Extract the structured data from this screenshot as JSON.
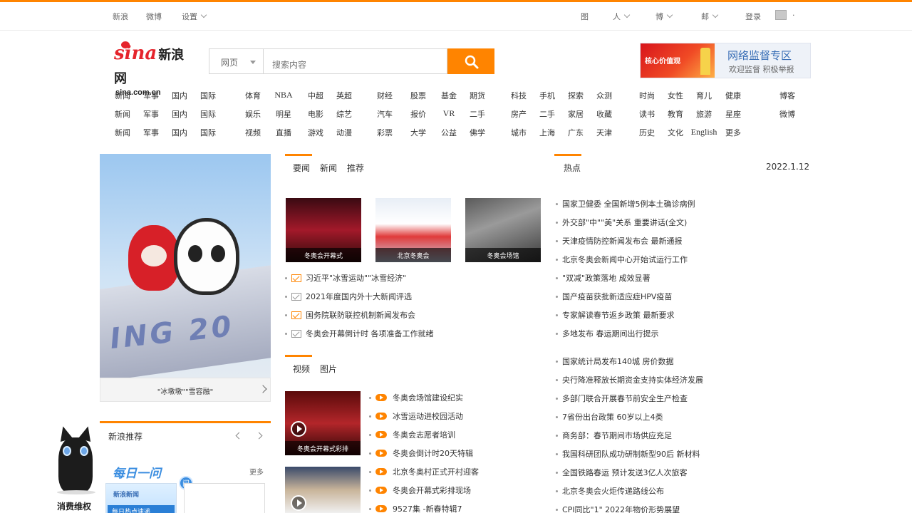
{
  "topbar": {
    "left_items": [
      "新浪",
      "微博",
      "设置"
    ],
    "right_items": [
      "图",
      "人",
      "博",
      "邮",
      "登录"
    ]
  },
  "logo": {
    "main": "sina",
    "cn": "新浪网",
    "sub": "sina.com.cn"
  },
  "search": {
    "select_label": "网页",
    "placeholder": "搜索内容"
  },
  "banner": {
    "left_text": "核心价值观",
    "title": "网络监督专区",
    "subtitle": "欢迎监督 积极举报"
  },
  "nav": {
    "rows": [
      [
        "新闻",
        "军事",
        "国内",
        "国际",
        "体育",
        "NBA",
        "中超",
        "英超",
        "财经",
        "股票",
        "基金",
        "期货",
        "科技",
        "手机",
        "探索",
        "众测",
        "时尚",
        "女性",
        "育儿",
        "健康",
        "博客"
      ],
      [
        "新闻",
        "军事",
        "国内",
        "国际",
        "娱乐",
        "明星",
        "电影",
        "综艺",
        "汽车",
        "报价",
        "VR",
        "二手",
        "房产",
        "二手",
        "家居",
        "收藏",
        "读书",
        "教育",
        "旅游",
        "星座",
        "微博"
      ],
      [
        "新闻",
        "军事",
        "国内",
        "国际",
        "视频",
        "直播",
        "游戏",
        "动漫",
        "彩票",
        "大学",
        "公益",
        "佛学",
        "城市",
        "上海",
        "广东",
        "天津",
        "历史",
        "文化",
        "English",
        "更多"
      ]
    ]
  },
  "hero": {
    "caption": "\"冰墩墩\"\"雪容融\""
  },
  "news_tabs": [
    "要闻",
    "新闻",
    "推荐"
  ],
  "right_tabs": [
    "热点"
  ],
  "date": "2022.1.12",
  "thumbs": [
    {
      "caption": "冬奥会开幕式"
    },
    {
      "caption": "北京冬奥会"
    },
    {
      "caption": "冬奥会场馆"
    }
  ],
  "news_left": [
    "习近平\"冰雪运动\"\"冰雪经济\"",
    "2021年度国内外十大新闻评选",
    "国务院联防联控机制新闻发布会",
    "冬奥会开幕倒计时 各项准备工作就绪"
  ],
  "news_right_1": [
    "国家卫健委 全国新增5例本土确诊病例",
    "外交部\"中\"\"美\"关系 重要讲话(全文)",
    "天津疫情防控新闻发布会 最新通报",
    "北京冬奥会新闻中心开始试运行工作",
    "\"双减\"政策落地 成效显著",
    "国产疫苗获批新适应症HPV疫苗",
    "专家解读春节返乡政策 最新要求",
    "多地发布 春运期间出行提示"
  ],
  "video_tabs": [
    "视频",
    "图片"
  ],
  "video_thumbs": [
    {
      "caption": "冬奥会开幕式彩排"
    },
    {
      "caption": ""
    }
  ],
  "video_list": [
    "冬奥会场馆建设纪实",
    "冰雪运动进校园活动",
    "冬奥会志愿者培训",
    "冬奥会倒计时20天特辑",
    "北京冬奥村正式开村迎客",
    "冬奥会开幕式彩排现场",
    "9527集 -新春特辑7"
  ],
  "news_right_2": [
    "国家统计局发布140城 房价数据",
    "央行降准释放长期资金支持实体经济发展",
    "多部门联合开展春节前安全生产检查",
    "7省份出台政策 60岁以上4类",
    "商务部：春节期间市场供应充足",
    "我国科研团队成功研制新型90后 新材料",
    "全国铁路春运 预计发送3亿人次旅客",
    "北京冬奥会火炬传递路线公布",
    "CPI同比\"1\" 2022年物价形势展望"
  ],
  "panel2": {
    "title": "新浪推荐",
    "daily_title": "每日一问",
    "badge": "问",
    "more": "更多",
    "card_brand": "新浪新闻",
    "card_text": "每日热点速递"
  },
  "mascot": {
    "label": "消费维权"
  }
}
